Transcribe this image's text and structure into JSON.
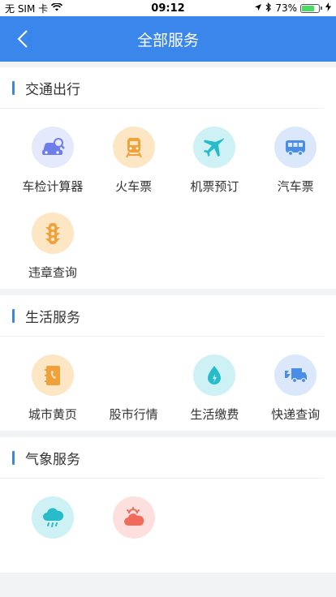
{
  "status": {
    "carrier": "无 SIM 卡",
    "time": "09:12",
    "battery": "73%",
    "battery_level": 0.73
  },
  "nav": {
    "title": "全部服务"
  },
  "sections": [
    {
      "title": "交通出行",
      "items": [
        {
          "label": "车检计算器",
          "icon": "car-search-icon"
        },
        {
          "label": "火车票",
          "icon": "train-icon"
        },
        {
          "label": "机票预订",
          "icon": "airplane-icon"
        },
        {
          "label": "汽车票",
          "icon": "bus-icon"
        },
        {
          "label": "违章查询",
          "icon": "traffic-light-icon"
        }
      ]
    },
    {
      "title": "生活服务",
      "items": [
        {
          "label": "城市黄页",
          "icon": "phonebook-icon"
        },
        {
          "label": "股市行情",
          "icon": "stock-icon"
        },
        {
          "label": "生活缴费",
          "icon": "water-drop-icon"
        },
        {
          "label": "快递查询",
          "icon": "truck-icon"
        }
      ]
    },
    {
      "title": "气象服务",
      "items": [
        {
          "label": "",
          "icon": "rain-cloud-icon"
        },
        {
          "label": "",
          "icon": "sun-cloud-icon"
        }
      ]
    }
  ],
  "colors": {
    "accent": "#3a86ea",
    "background": "#f2f3f5"
  }
}
